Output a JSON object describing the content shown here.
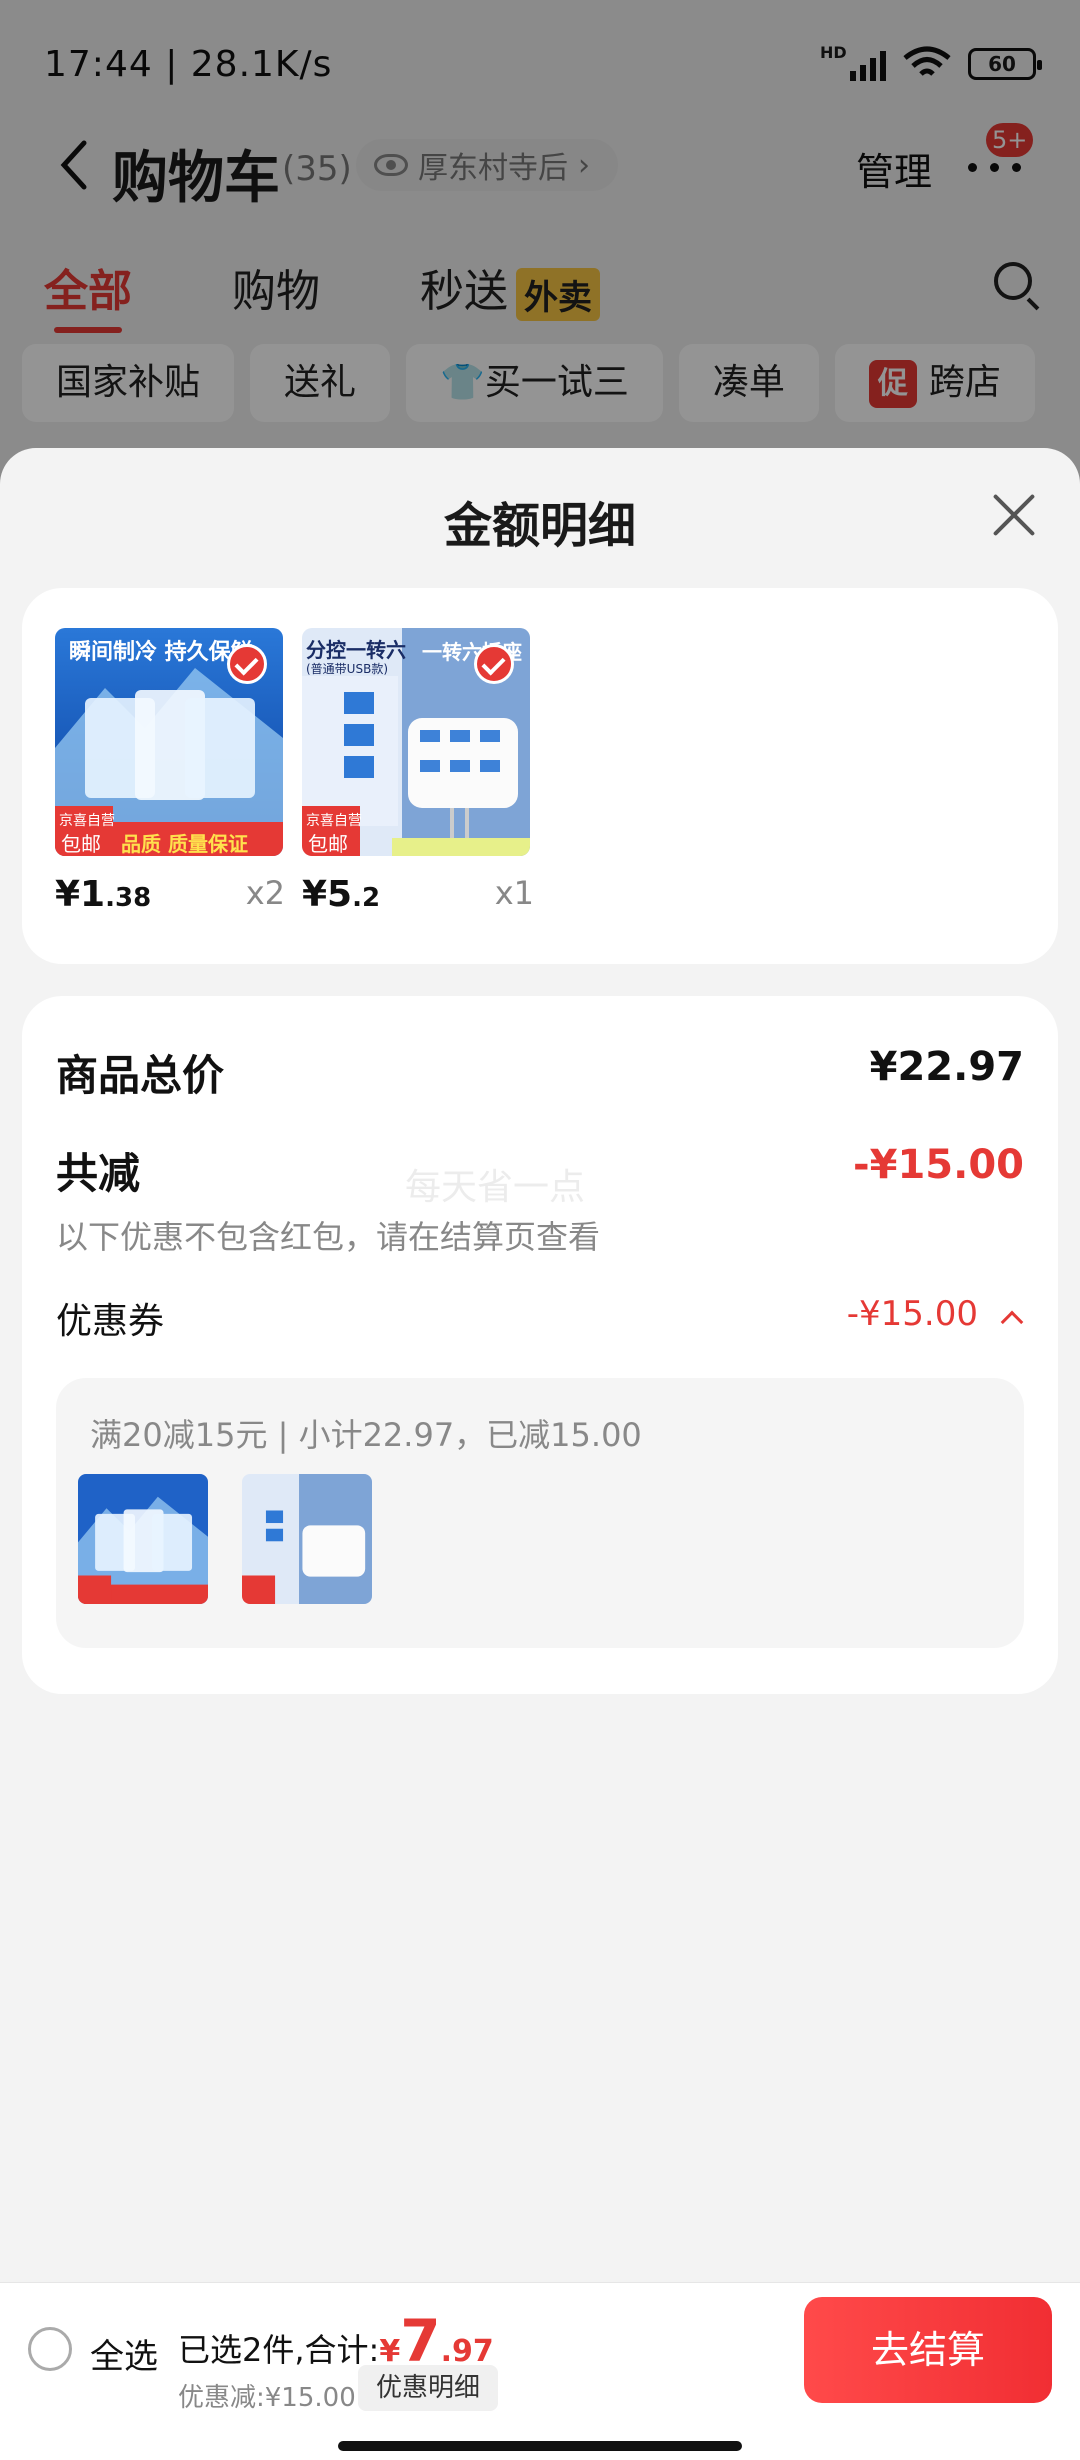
{
  "status_bar": {
    "time_speed": "17:44 | 28.1K/s",
    "network": "HD",
    "battery": "60"
  },
  "nav": {
    "title": "购物车",
    "count": "(35)",
    "location": "厚东村寺后",
    "location_arrow": "›",
    "manage": "管理",
    "badge": "5+"
  },
  "tabs": [
    {
      "label": "全部",
      "active": true
    },
    {
      "label": "购物"
    },
    {
      "label": "秒送",
      "tag": "外卖"
    }
  ],
  "chips": [
    "国家补贴",
    "送礼",
    "买一试三",
    "凑单",
    "跨店"
  ],
  "chip_promo_tag": "促",
  "sheet": {
    "title": "金额明细",
    "products": [
      {
        "price_int": "¥1",
        "price_dec": ".38",
        "qty": "x2",
        "banner_top": "瞬间制冷  持久保鲜",
        "tag_top": "京喜自营",
        "tag_bottom": "包邮",
        "strip": "品质 质量保证"
      },
      {
        "price_int": "¥5",
        "price_dec": ".2",
        "qty": "x1",
        "banner_top": "分控一转六",
        "banner_sub": "(普通带USB款)",
        "banner_right": "一转六插座",
        "tag_top": "京喜自营",
        "tag_bottom": "包邮"
      }
    ],
    "total_label": "商品总价",
    "total_value": "¥22.97",
    "discount_label": "共减",
    "discount_value": "-¥15.00",
    "note": "以下优惠不包含红包，请在结算页查看",
    "coupon_label": "优惠券",
    "coupon_value": "-¥15.00",
    "coupon_rule": "满20减15元 | 小计22.97，已减15.00",
    "watermark": "每天省一点"
  },
  "bottom": {
    "select_all": "全选",
    "summary": "已选2件,合计:",
    "yen": "¥",
    "total_int": "7",
    "total_dec": ".97",
    "discount": "优惠减:¥15.00",
    "detail_button": "优惠明细",
    "checkout": "去结算"
  },
  "colors": {
    "accent": "#e53935",
    "tag_yellow": "#f6c544"
  }
}
